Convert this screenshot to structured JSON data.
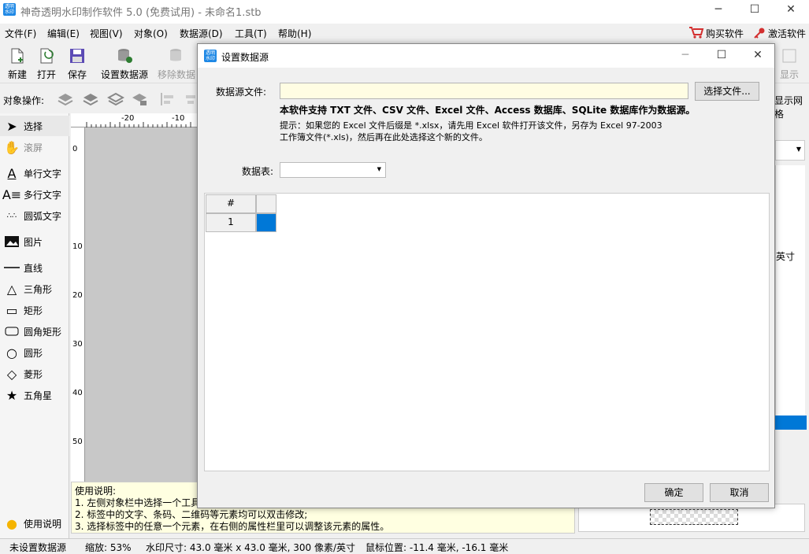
{
  "app": {
    "title": "神奇透明水印制作软件 5.0 (免费试用) - 未命名1.stb",
    "icon_text": "透明水印"
  },
  "menu": [
    "文件(F)",
    "编辑(E)",
    "视图(V)",
    "对象(O)",
    "数据源(D)",
    "工具(T)",
    "帮助(H)"
  ],
  "menu_right": {
    "buy": "购买软件",
    "activate": "激活软件"
  },
  "toolbar": {
    "new": "新建",
    "open": "打开",
    "save": "保存",
    "set_ds": "设置数据源",
    "remove_ds": "移除数据",
    "display": "显示"
  },
  "objbar": {
    "label": "对象操作:",
    "show_grid": "显示网格"
  },
  "tools": [
    "选择",
    "滚屏",
    "单行文字",
    "多行文字",
    "圆弧文字",
    "图片",
    "直线",
    "三角形",
    "矩形",
    "圆角矩形",
    "圆形",
    "菱形",
    "五角星"
  ],
  "help_btn": "使用说明",
  "help": {
    "title": "使用说明:",
    "line1": "1. 左侧对象栏中选择一个工具",
    "line2": "2. 标签中的文字、条码、二维码等元素均可以双击修改;",
    "line3": "3. 选择标签中的任意一个元素，在右侧的属性栏里可以调整该元素的属性。"
  },
  "ruler_h": [
    "-20",
    "-10"
  ],
  "ruler_v": [
    "0",
    "10",
    "20",
    "30",
    "40",
    "50"
  ],
  "right_panel": {
    "unit": "英寸"
  },
  "status": {
    "ds": "未设置数据源",
    "zoom": "缩放: 53%",
    "size": "水印尺寸: 43.0 毫米 x 43.0 毫米, 300 像素/英寸",
    "mouse": "鼠标位置: -11.4 毫米, -16.1 毫米"
  },
  "dialog": {
    "title": "设置数据源",
    "file_label": "数据源文件:",
    "file_value": "",
    "choose_btn": "选择文件...",
    "support_text": "本软件支持 TXT 文件、CSV 文件、Excel 文件、Access 数据库、SQLite 数据库作为数据源。",
    "hint_line1": "提示：如果您的 Excel 文件后缀是 *.xlsx，请先用 Excel 软件打开该文件，另存为 Excel 97-2003",
    "hint_line2": "工作簿文件(*.xls)，然后再在此处选择这个新的文件。",
    "table_label": "数据表:",
    "table_value": "",
    "grid_header": "#",
    "grid_row": "1",
    "ok": "确定",
    "cancel": "取消"
  },
  "colors": {
    "accent": "#0078d7",
    "help_bg": "#ffffe1",
    "input_bg": "#fffde3",
    "select_cell": "#0078d7"
  }
}
